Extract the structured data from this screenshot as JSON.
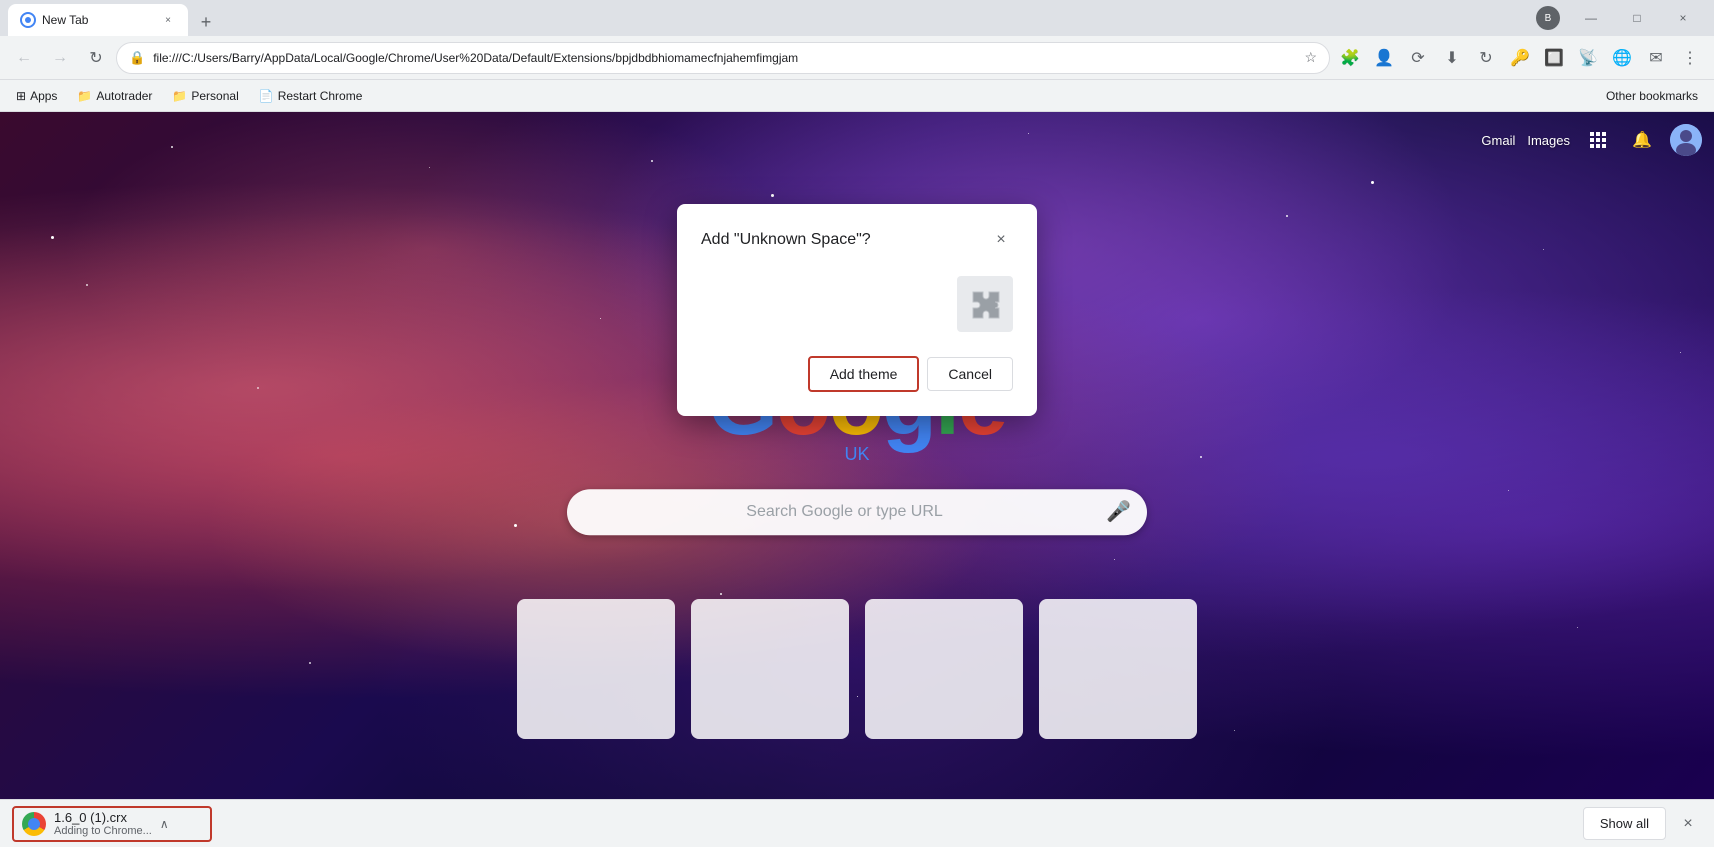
{
  "window": {
    "title": "New Tab",
    "user": "Barry"
  },
  "tab": {
    "title": "New Tab",
    "close_label": "×"
  },
  "toolbar": {
    "back_title": "Back",
    "forward_title": "Forward",
    "refresh_title": "Refresh",
    "address": "file:///C:/Users/Barry/AppData/Local/Google/Chrome/User%20Data/Default/Extensions/bpjdbdbhiomamecfnjahemfimgjam",
    "new_tab_label": "+"
  },
  "bookmarks": {
    "items": [
      {
        "label": "Apps",
        "icon": "⊞"
      },
      {
        "label": "Autotrader",
        "icon": "📁"
      },
      {
        "label": "Personal",
        "icon": "📁"
      },
      {
        "label": "Restart Chrome",
        "icon": "📄"
      }
    ],
    "other_label": "Other bookmarks"
  },
  "page": {
    "gmail_label": "Gmail",
    "images_label": "Images",
    "google_text": "Google",
    "google_uk_label": "UK",
    "search_placeholder": "Search Google or type URL"
  },
  "dialog": {
    "title": "Add \"Unknown Space\"?",
    "close_label": "×",
    "add_theme_label": "Add theme",
    "cancel_label": "Cancel",
    "puzzle_icon": "🧩"
  },
  "download_bar": {
    "file_name": "1.6_0 (1).crx",
    "file_status": "Adding to Chrome...",
    "show_all_label": "Show all",
    "close_label": "×",
    "chevron_label": "∧"
  },
  "window_controls": {
    "minimize": "—",
    "maximize": "□",
    "close": "×"
  }
}
